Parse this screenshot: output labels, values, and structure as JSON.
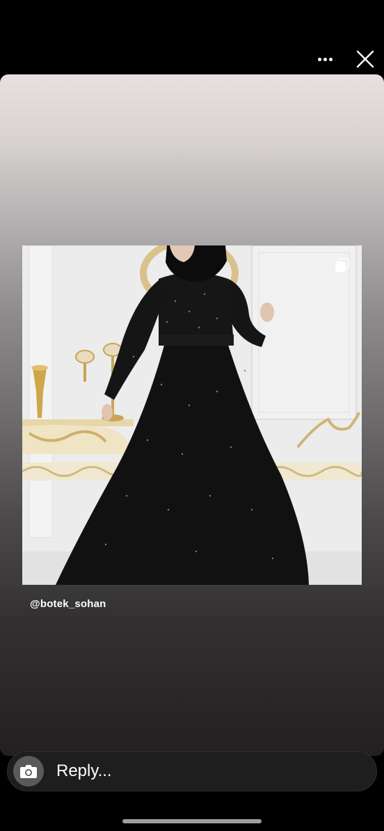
{
  "top_bar": {
    "more_icon": "more-horizontal-icon",
    "close_icon": "close-icon"
  },
  "story": {
    "product_image": "black-sequin-evening-gown-photo",
    "multi_select_icon": "multiple-images-icon",
    "mention_handle": "@botek_sohan"
  },
  "reply_bar": {
    "camera_icon": "camera-icon",
    "placeholder": "Reply..."
  },
  "colors": {
    "background": "#000000",
    "card_top": "#e7e1df",
    "card_bottom": "#222021",
    "reply_bar": "#1e1e1f",
    "camera_button": "#5a5a5d",
    "text": "#ffffff"
  }
}
